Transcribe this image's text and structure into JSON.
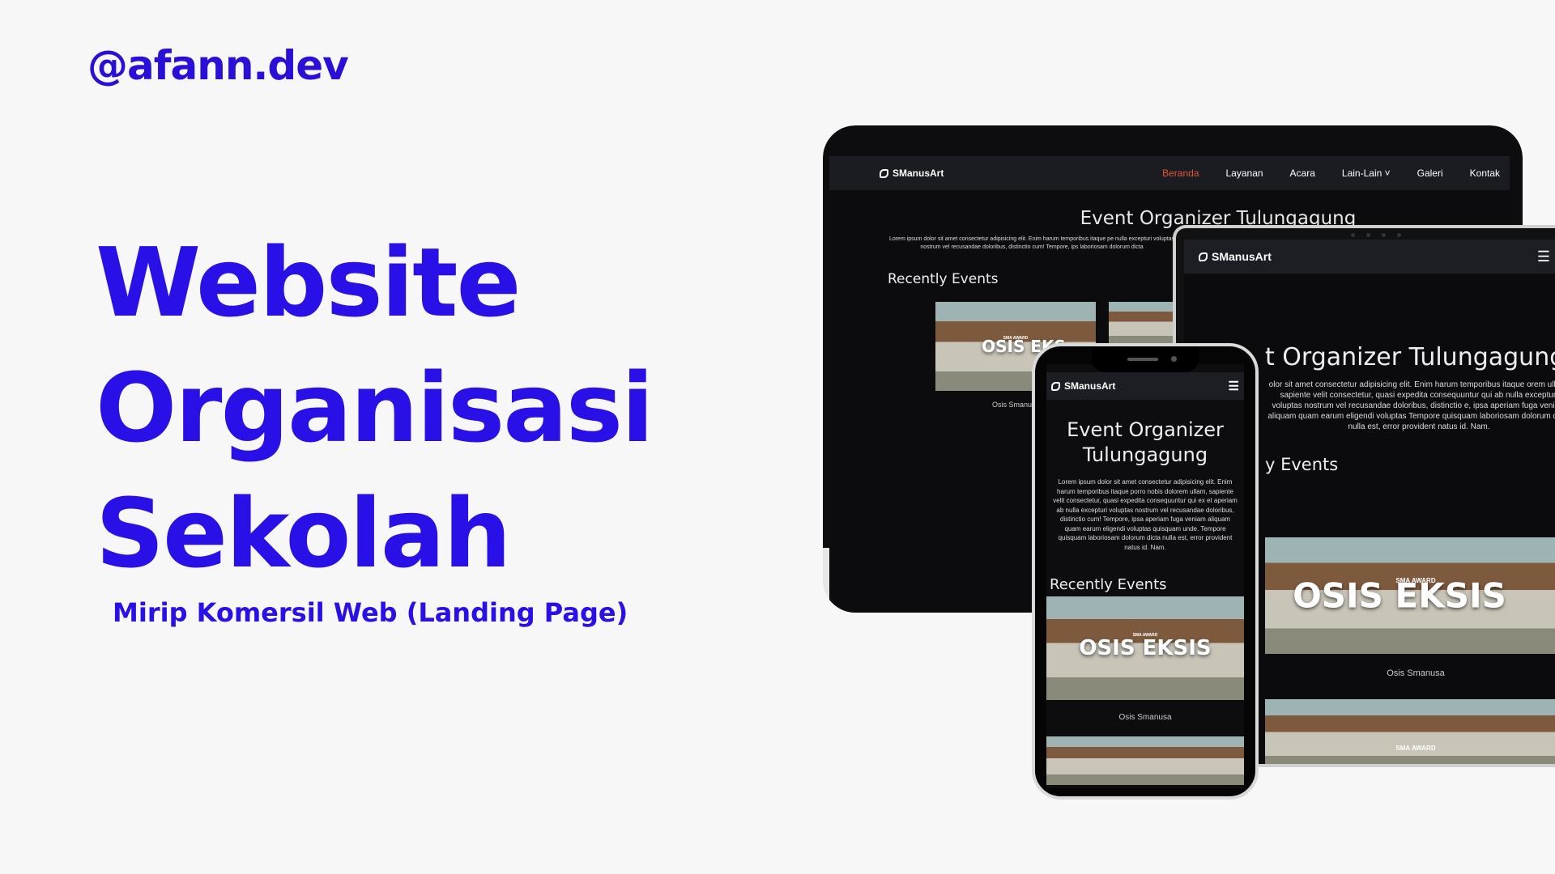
{
  "handle": "@afann.dev",
  "headline": [
    "Website",
    "Organisasi",
    "Sekolah"
  ],
  "subline": "Mirip Komersil Web (Landing Page)",
  "site": {
    "brand": "SManusArt",
    "nav": [
      "Beranda",
      "Layanan",
      "Acara",
      "Lain-Lain ˅",
      "Galeri",
      "Kontak"
    ],
    "title": "Event Organizer Tulungagung",
    "title_phone_1": "Event Organizer",
    "title_phone_2": "Tulungagung",
    "tablet_title": "t Organizer Tulungagung",
    "lorem": "Lorem ipsum dolor sit amet consectetur adipisicing elit. Enim harum temporibus itaque porro nobis dolorem ullam, sapiente velit consectetur, quasi expedita consequuntur qui ex et aperiam ab nulla excepturi voluptas nostrum vel recusandae doloribus, distinctio cum! Tempore, ipsa aperiam fuga veniam aliquam quam earum eligendi voluptas quisquam unde. Tempore quisquam laboriosam dolorum dicta nulla est, error provident natus id. Nam.",
    "lorem_desktop": "Lorem ipsum dolor sit amet consectetur adipisicing elit. Enim harum temporibus itaque pe nulla excepturi voluptas nostrum vel recusandae doloribus, distinctio cum! Tempore, ips laboriosam dolorum dicta",
    "lorem_tablet": "olor sit amet consectetur adipisicing elit. Enim harum temporibus itaque orem ullam, sapiente velit consectetur, quasi expedita consequuntur qui ab nulla excepturi voluptas nostrum vel recusandae doloribus, distinctio e, ipsa aperiam fuga veniam aliquam quam earum eligendi voluptas Tempore quisquam laboriosam dolorum dicta nulla est, error provident natus id. Nam.",
    "recent": "Recently Events",
    "recent_tablet": "y Events",
    "event_text": "OSIS EKSIS",
    "event_text_cut": "OSIS EKS",
    "award": "SMA AWARD",
    "caption": "Osis Smanusa",
    "caption_cut": "Osis Smanu"
  },
  "menu_icon": "hamburger-menu-icon",
  "logo_icon": "brand-logo-icon",
  "colors": {
    "accent": "#2810e6",
    "active_nav": "#e0573a",
    "screen_bg": "#0c0c0e"
  }
}
